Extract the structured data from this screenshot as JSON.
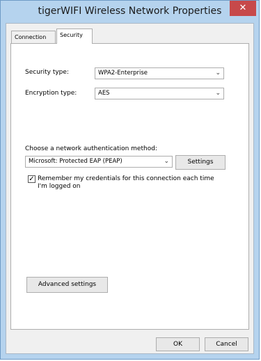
{
  "window": {
    "title": "tigerWIFI Wireless Network Properties",
    "close_label": "✕"
  },
  "tabs": [
    {
      "label": "Connection",
      "active": false
    },
    {
      "label": "Security",
      "active": true
    }
  ],
  "security": {
    "security_type_label": "Security type:",
    "security_type_value": "WPA2-Enterprise",
    "encryption_type_label": "Encryption type:",
    "encryption_type_value": "AES",
    "auth_method_label": "Choose a network authentication method:",
    "auth_method_value": "Microsoft: Protected EAP (PEAP)",
    "settings_button": "Settings",
    "remember_checked": true,
    "remember_label": "Remember my credentials for this connection each time I'm logged on",
    "advanced_button": "Advanced settings"
  },
  "footer": {
    "ok_button": "OK",
    "cancel_button": "Cancel"
  },
  "icons": {
    "chevron": "⌄",
    "check": "✓"
  }
}
